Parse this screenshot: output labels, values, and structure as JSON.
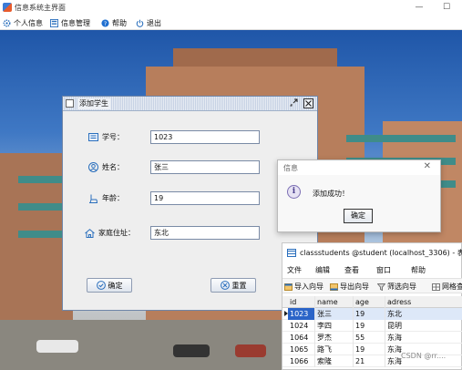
{
  "main_window": {
    "title": "信息系统主界面",
    "minimize": "—",
    "maximize": "☐"
  },
  "menubar": {
    "items": [
      {
        "label": "个人信息",
        "icon": "gear-icon"
      },
      {
        "label": "信息管理",
        "icon": "grid-icon"
      },
      {
        "label": "帮助",
        "icon": "help-icon"
      },
      {
        "label": "退出",
        "icon": "power-icon"
      }
    ]
  },
  "add_student": {
    "title": "添加学生",
    "fields": [
      {
        "label": "学号：",
        "value": "1023",
        "icon": "id-card-icon"
      },
      {
        "label": "姓名：",
        "value": "张三",
        "icon": "user-icon"
      },
      {
        "label": "年龄：",
        "value": "19",
        "icon": "chair-icon"
      },
      {
        "label": "家庭住址：",
        "value": "东北",
        "icon": "house-icon"
      }
    ],
    "confirm_label": "确定",
    "reset_label": "重置"
  },
  "message_dialog": {
    "title": "信息",
    "text": "添加成功！",
    "ok_label": "确定",
    "icon": "info-icon"
  },
  "table_window": {
    "title": "classstudents @student (localhost_3306) - 表",
    "menu": [
      "文件",
      "编辑",
      "查看",
      "窗口",
      "帮助"
    ],
    "toolbar": [
      {
        "label": "导入向导",
        "icon": "import-icon"
      },
      {
        "label": "导出向导",
        "icon": "export-icon"
      },
      {
        "label": "筛选向导",
        "icon": "filter-icon"
      },
      {
        "label": "网格查",
        "icon": "grid-view-icon"
      }
    ],
    "columns": [
      "id",
      "name",
      "age",
      "adress"
    ],
    "rows": [
      [
        "1023",
        "张三",
        "19",
        "东北"
      ],
      [
        "1024",
        "李四",
        "19",
        "昆明"
      ],
      [
        "1064",
        "罗杰",
        "55",
        "东海"
      ],
      [
        "1065",
        "路飞",
        "19",
        "东海"
      ],
      [
        "1066",
        "索隆",
        "21",
        "东海"
      ]
    ],
    "selected_row": 0
  },
  "watermark": "CSDN @rr...."
}
